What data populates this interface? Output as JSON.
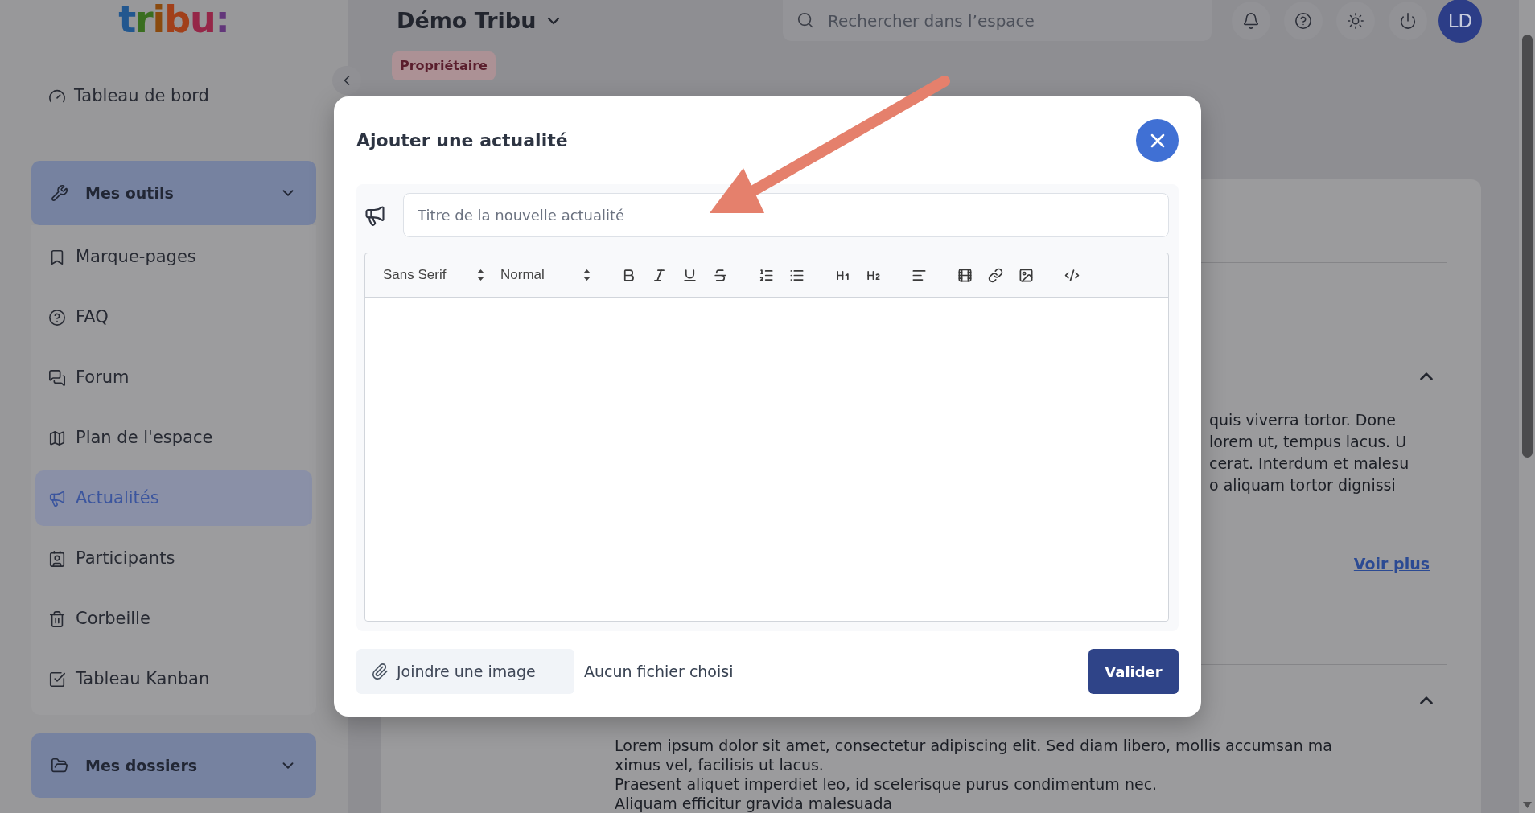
{
  "logo": {
    "text": "tribu:"
  },
  "sidebar": {
    "dashboard": "Tableau de bord",
    "sections": [
      {
        "title": "Mes outils",
        "items": [
          {
            "label": "Marque-pages",
            "selected": false
          },
          {
            "label": "FAQ",
            "selected": false
          },
          {
            "label": "Forum",
            "selected": false
          },
          {
            "label": "Plan de l'espace",
            "selected": false
          },
          {
            "label": "Actualités",
            "selected": true
          },
          {
            "label": "Participants",
            "selected": false
          },
          {
            "label": "Corbeille",
            "selected": false
          },
          {
            "label": "Tableau Kanban",
            "selected": false
          }
        ]
      },
      {
        "title": "Mes dossiers"
      }
    ]
  },
  "topbar": {
    "space_name": "Démo Tribu",
    "role_badge": "Propriétaire",
    "search": {
      "placeholder": "Rechercher dans l’espace"
    },
    "avatar": "LD"
  },
  "content": {
    "sections": [
      {
        "lines": [
          "quis viverra tortor. Done",
          "lorem ut, tempus lacus. U",
          "cerat. Interdum et malesu",
          "o aliquam tortor dignissi"
        ],
        "link": "Voir plus"
      },
      {
        "lines": [
          "Lorem ipsum dolor sit amet, consectetur adipiscing elit. Sed diam libero, mollis accumsan ma",
          "ximus vel, facilisis ut lacus.",
          "Praesent aliquet imperdiet leo, id scelerisque purus condimentum nec.",
          "Aliquam efficitur gravida malesuada"
        ]
      }
    ]
  },
  "modal": {
    "title": "Ajouter une actualité",
    "title_field": {
      "placeholder": "Titre de la nouvelle actualité"
    },
    "editor": {
      "font": "Sans Serif",
      "size": "Normal"
    },
    "attach_button": "Joindre une image",
    "file_status": "Aucun fichier choisi",
    "submit_button": "Valider"
  }
}
